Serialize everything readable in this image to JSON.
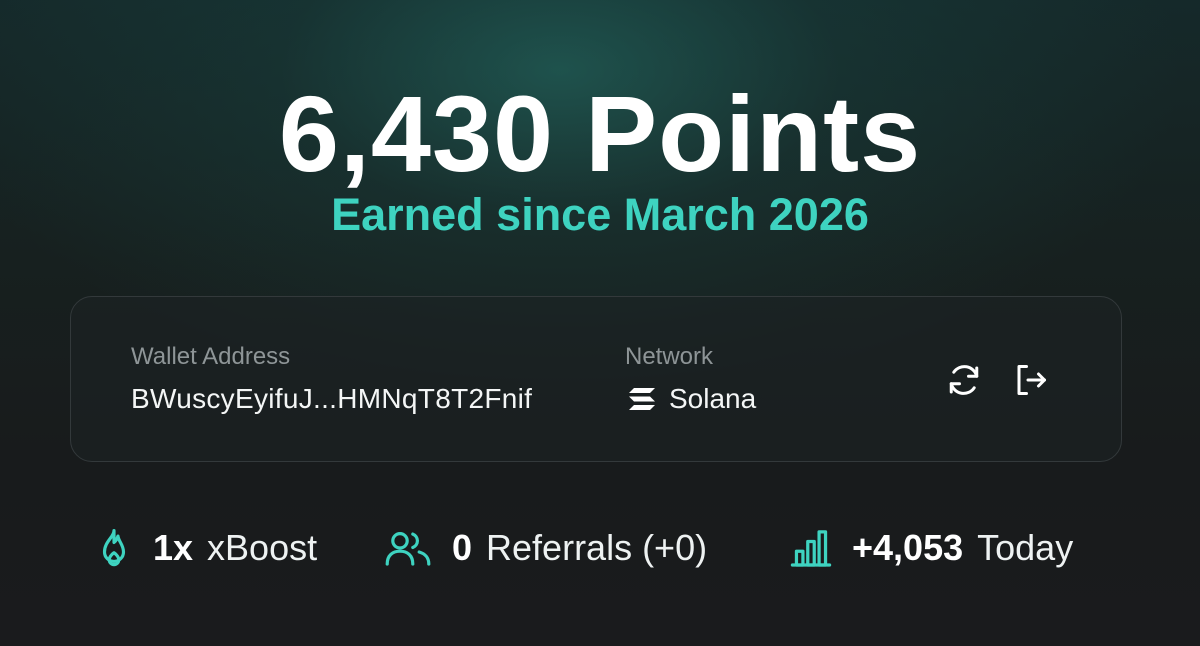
{
  "points": {
    "headline": "6,430 Points",
    "subtitle": "Earned since March 2026"
  },
  "wallet": {
    "address_label": "Wallet Address",
    "address_value": "BWuscyEyifuJ...HMNqT8T2Fnif",
    "network_label": "Network",
    "network_value": "Solana",
    "network_icon": "solana-logo-icon",
    "refresh_icon": "refresh-icon",
    "logout_icon": "logout-icon"
  },
  "stats": {
    "boost": {
      "icon": "flame-icon",
      "value": "1x",
      "label": "xBoost"
    },
    "referrals": {
      "icon": "users-icon",
      "value": "0",
      "label": "Referrals (+0)"
    },
    "today": {
      "icon": "bar-chart-icon",
      "value": "+4,053",
      "label": "Today"
    }
  },
  "colors": {
    "accent": "#3ed3c0",
    "card_border": "#33393b",
    "muted_text": "#8e9597",
    "background": "#181b1c"
  }
}
